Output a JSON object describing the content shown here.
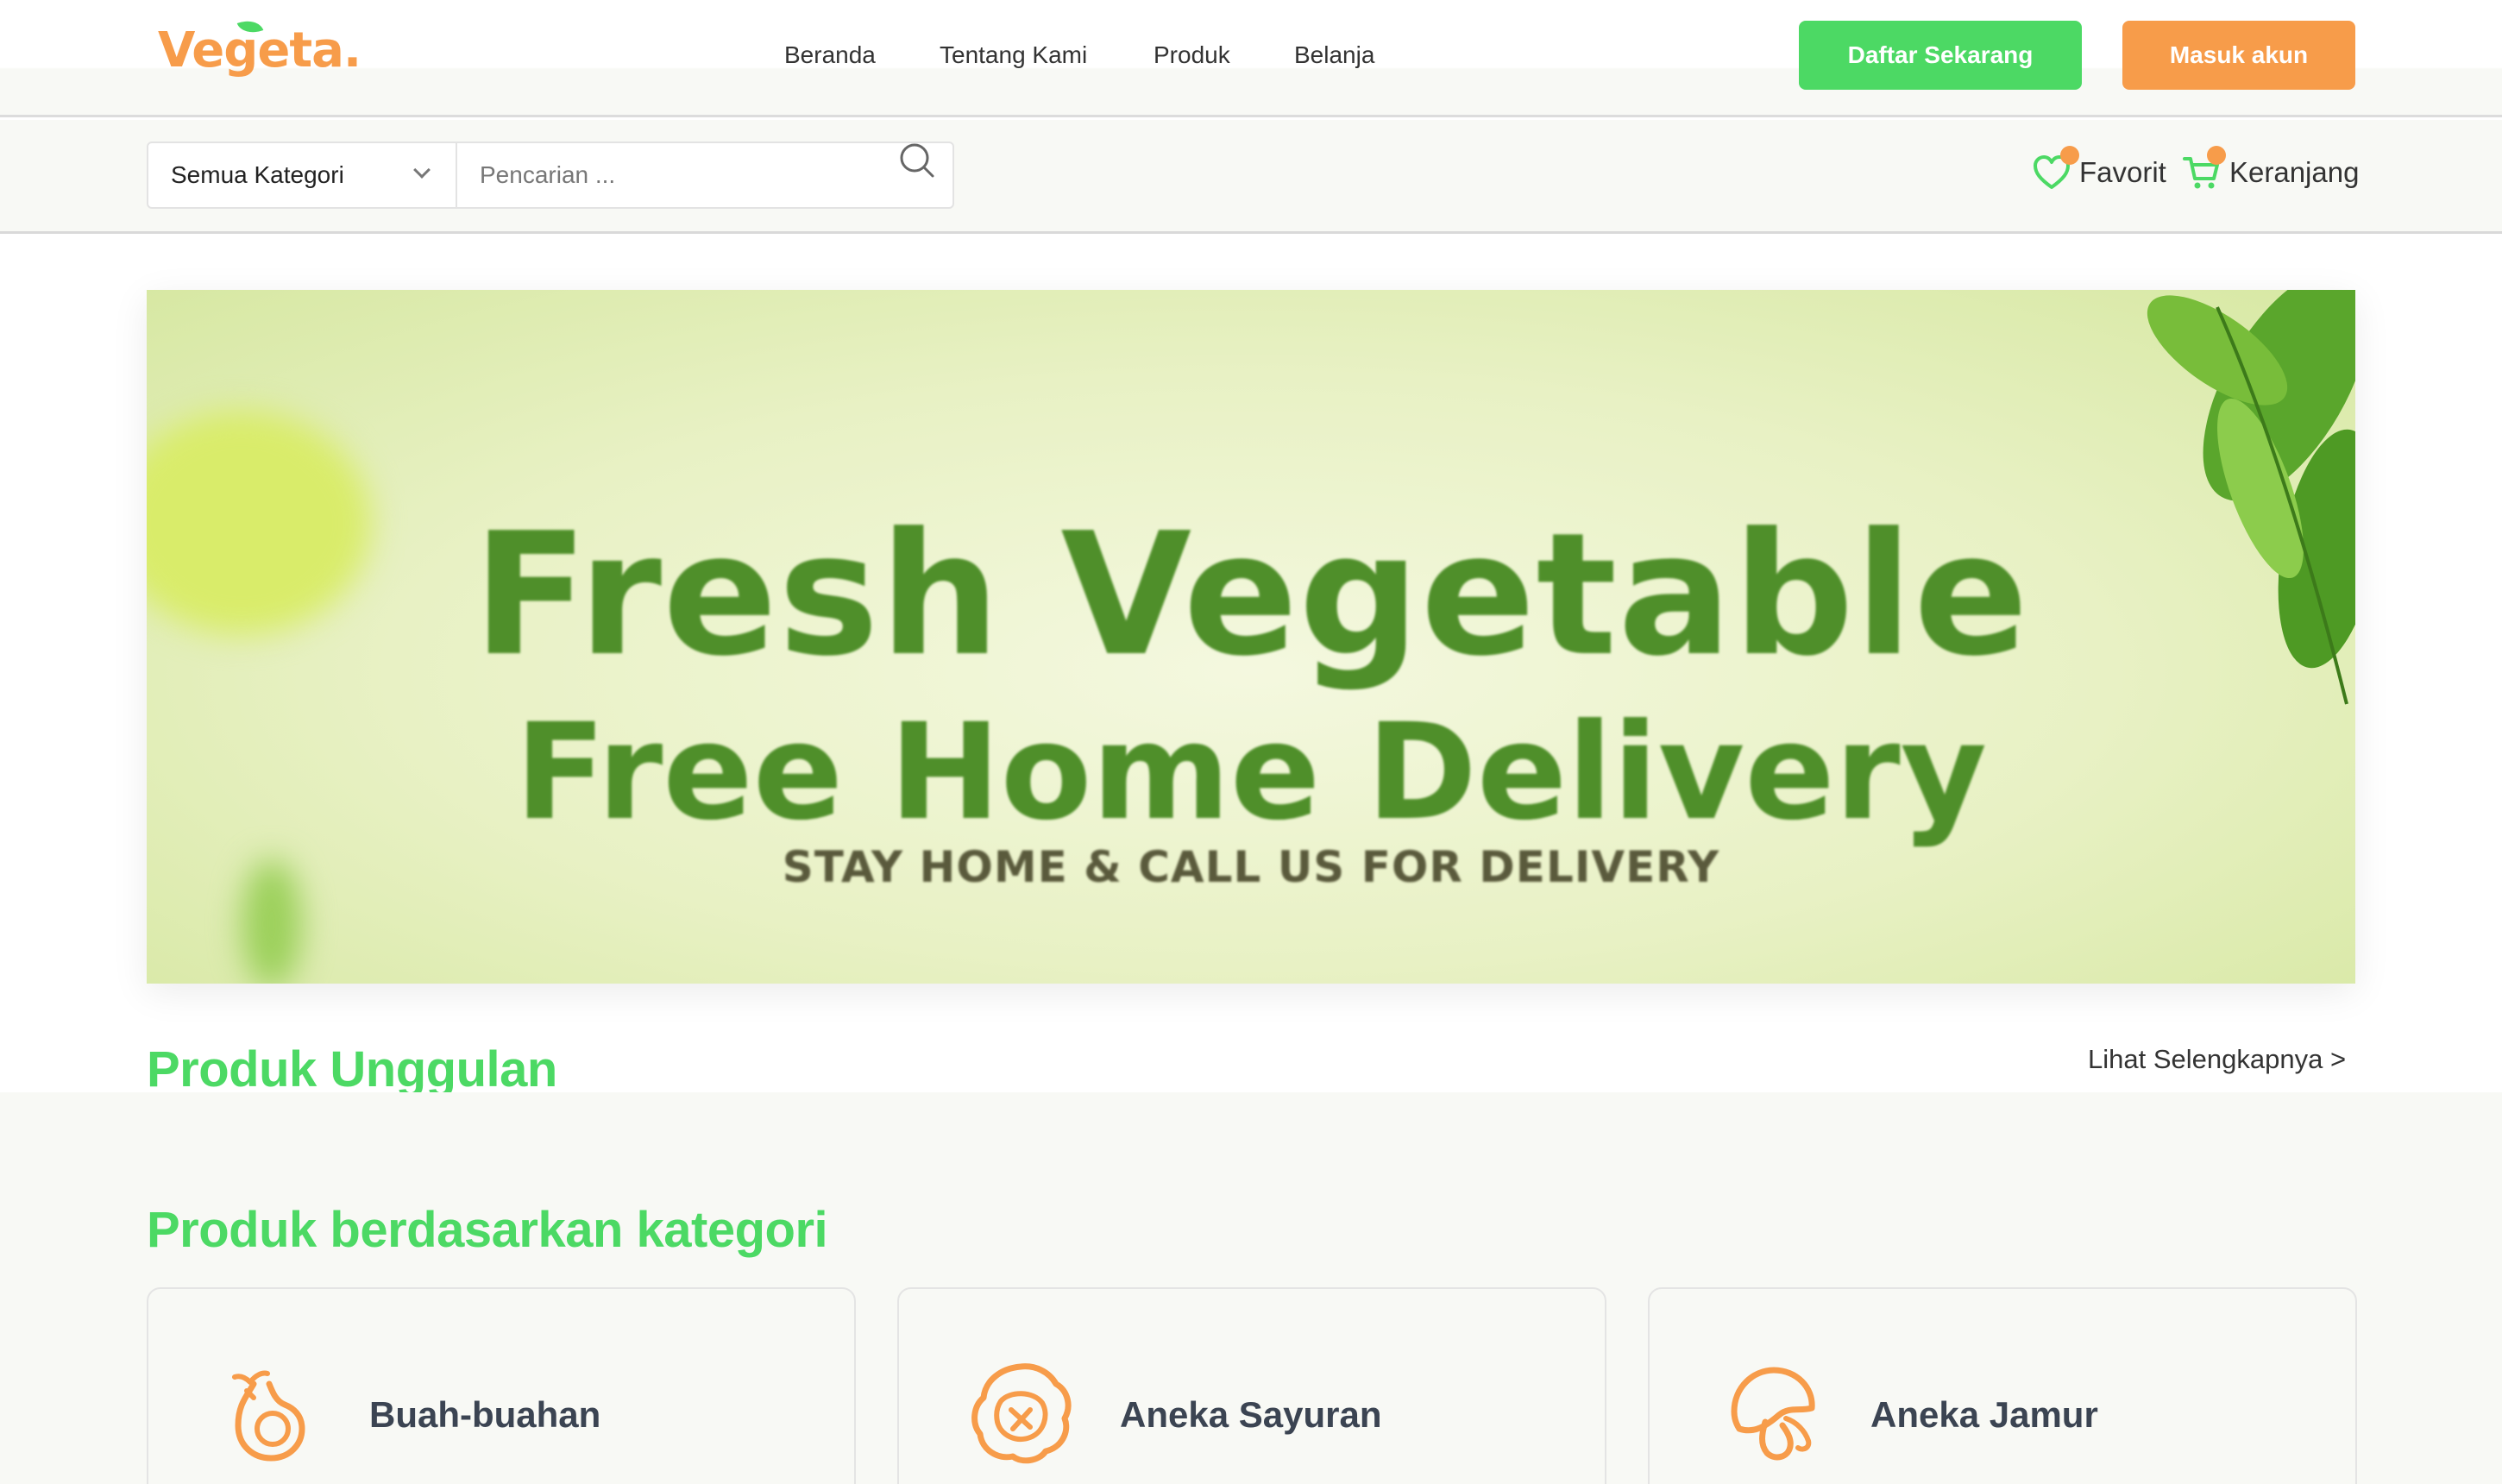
{
  "brand": {
    "logo": "Vegeta.",
    "primary": "#4cd964",
    "accent": "#f79c4a"
  },
  "nav": {
    "items": [
      {
        "label": "Beranda"
      },
      {
        "label": "Tentang Kami"
      },
      {
        "label": "Produk"
      },
      {
        "label": "Belanja"
      }
    ],
    "register_label": "Daftar Sekarang",
    "login_label": "Masuk akun"
  },
  "search": {
    "category_selected": "Semua Kategori",
    "placeholder": "Pencarian ...",
    "search_icon": "search-icon"
  },
  "user_actions": {
    "favorite_label": "Favorit",
    "favorite_icon": "heart-icon",
    "cart_label": "Keranjang",
    "cart_icon": "cart-icon"
  },
  "banner": {
    "line1": "Fresh Vegetable",
    "line2": "Free Home Delivery",
    "line3": "STAY HOME & CALL US FOR DELIVERY"
  },
  "featured": {
    "title": "Produk Unggulan",
    "see_more": "Lihat Selengkapnya >"
  },
  "categories": {
    "title": "Produk berdasarkan kategori",
    "items": [
      {
        "label": "Buah-buahan",
        "icon": "pear-icon"
      },
      {
        "label": "Aneka Sayuran",
        "icon": "cabbage-icon"
      },
      {
        "label": "Aneka Jamur",
        "icon": "mushroom-icon"
      }
    ]
  }
}
